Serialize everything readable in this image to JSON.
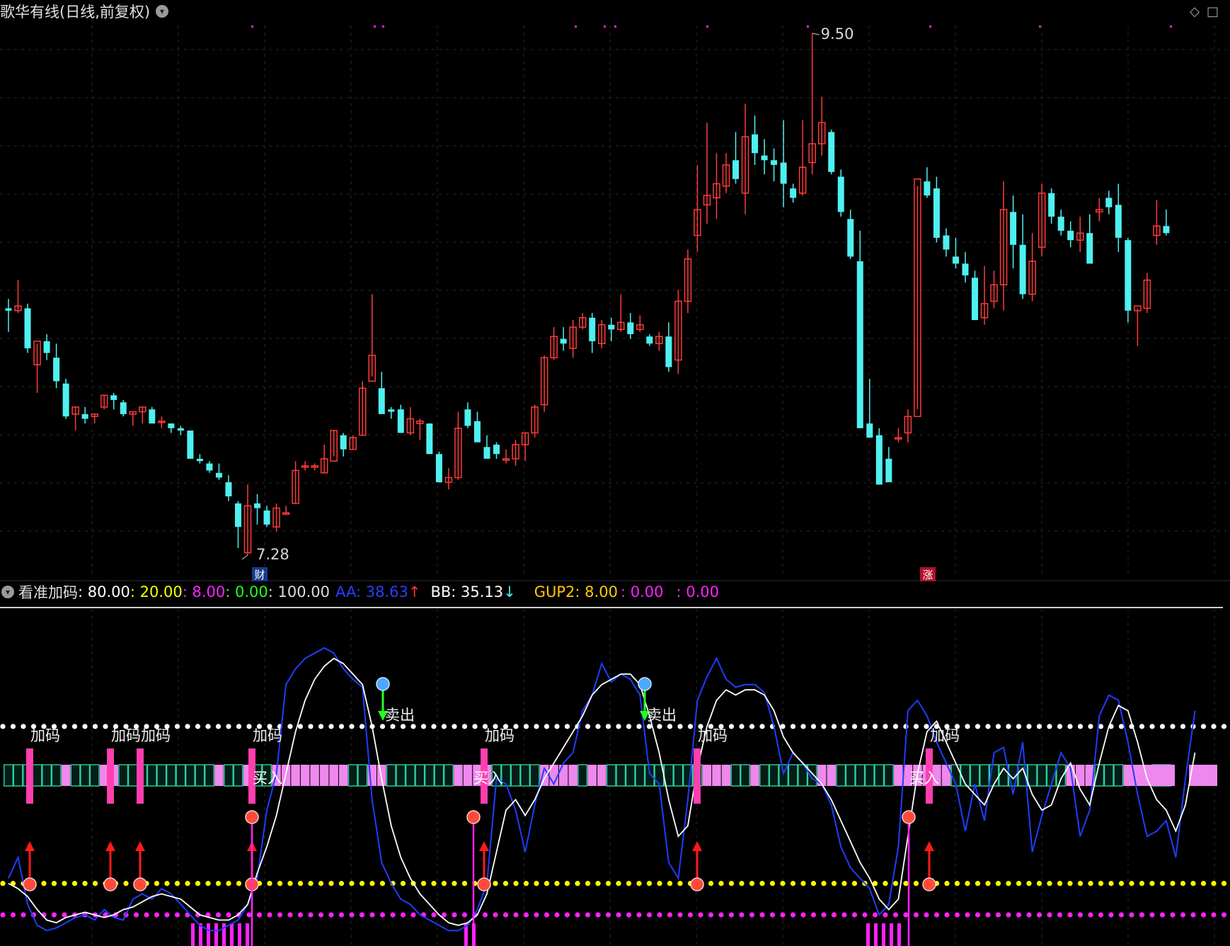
{
  "window": {
    "title": "歌华有线(日线,前复权)"
  },
  "colors": {
    "bg": "#000000",
    "up": "#ff3b3b",
    "down": "#4ff0f0",
    "grid": "#2a2a2a",
    "white": "#ffffff",
    "yellow": "#ffff00",
    "magenta": "#ff22ff",
    "blue": "#1f3dff",
    "green": "#22ff22",
    "pinkBlock": "#ee88ee",
    "tealBlock": "#2fd0a0",
    "hotPink": "#ff3fae"
  },
  "price_panel": {
    "high_label": "9.50",
    "low_label": "7.28",
    "badge_cai": "财",
    "badge_zhang": "涨"
  },
  "indicator_header": {
    "name": "看准加码",
    "v1": ": 80.00",
    "v2": ": 20.00",
    "v3": ": 8.00",
    "v4": ": 0.00",
    "v5": ": 100.00",
    "aa_label": "AA: 38.63",
    "aa_arrow": "↑",
    "bb_label": "BB: 35.13",
    "bb_arrow": "↓",
    "gup_label": "GUP2: 8.00",
    "g1": ": 0.00",
    "g2": ": 0.00"
  },
  "signals": {
    "add_label": "加码",
    "sell_label": "卖出",
    "buy_label": "买入"
  },
  "chart_data": [
    {
      "type": "candlestick",
      "title": "歌华有线(日线,前复权)",
      "ylim": [
        7.1,
        9.6
      ],
      "annotations": [
        {
          "text": "9.50",
          "at": "max high"
        },
        {
          "text": "7.28",
          "at": "min low"
        }
      ],
      "ohlc": [
        [
          8.33,
          8.37,
          8.23,
          8.32
        ],
        [
          8.32,
          8.45,
          8.31,
          8.34
        ],
        [
          8.33,
          8.35,
          8.14,
          8.16
        ],
        [
          8.09,
          8.18,
          7.97,
          8.19
        ],
        [
          8.19,
          8.22,
          8.11,
          8.14
        ],
        [
          8.12,
          8.18,
          7.99,
          8.02
        ],
        [
          8.01,
          8.03,
          7.86,
          7.87
        ],
        [
          7.88,
          7.91,
          7.81,
          7.91
        ],
        [
          7.88,
          7.91,
          7.84,
          7.86
        ],
        [
          7.87,
          7.88,
          7.84,
          7.88
        ],
        [
          7.91,
          7.96,
          7.9,
          7.96
        ],
        [
          7.96,
          7.97,
          7.9,
          7.94
        ],
        [
          7.93,
          7.94,
          7.87,
          7.88
        ],
        [
          7.88,
          7.89,
          7.83,
          7.89
        ],
        [
          7.89,
          7.91,
          7.84,
          7.91
        ],
        [
          7.9,
          7.91,
          7.84,
          7.84
        ],
        [
          7.85,
          7.87,
          7.82,
          7.85
        ],
        [
          7.84,
          7.84,
          7.8,
          7.82
        ],
        [
          7.82,
          7.83,
          7.79,
          7.81
        ],
        [
          7.81,
          7.81,
          7.7,
          7.69
        ],
        [
          7.69,
          7.71,
          7.67,
          7.68
        ],
        [
          7.67,
          7.68,
          7.63,
          7.64
        ],
        [
          7.63,
          7.67,
          7.6,
          7.61
        ],
        [
          7.59,
          7.62,
          7.51,
          7.53
        ],
        [
          7.5,
          7.51,
          7.31,
          7.4
        ],
        [
          7.29,
          7.58,
          7.28,
          7.49
        ],
        [
          7.5,
          7.54,
          7.41,
          7.48
        ],
        [
          7.47,
          7.49,
          7.4,
          7.41
        ],
        [
          7.4,
          7.5,
          7.38,
          7.48
        ],
        [
          7.46,
          7.49,
          7.45,
          7.46
        ],
        [
          7.5,
          7.68,
          7.5,
          7.64
        ],
        [
          7.66,
          7.68,
          7.64,
          7.66
        ],
        [
          7.66,
          7.67,
          7.64,
          7.66
        ],
        [
          7.63,
          7.75,
          7.63,
          7.69
        ],
        [
          7.68,
          7.81,
          7.7,
          7.81
        ],
        [
          7.79,
          7.8,
          7.7,
          7.73
        ],
        [
          7.73,
          7.79,
          7.73,
          7.78
        ],
        [
          7.79,
          8.02,
          7.79,
          7.99
        ],
        [
          8.02,
          8.39,
          8.04,
          8.13
        ],
        [
          7.99,
          8.06,
          7.89,
          7.88
        ],
        [
          7.9,
          7.91,
          7.86,
          7.89
        ],
        [
          7.9,
          7.92,
          7.8,
          7.8
        ],
        [
          7.8,
          7.91,
          7.79,
          7.86
        ],
        [
          7.84,
          7.86,
          7.77,
          7.85
        ],
        [
          7.84,
          7.84,
          7.73,
          7.71
        ],
        [
          7.71,
          7.72,
          7.59,
          7.59
        ],
        [
          7.59,
          7.65,
          7.56,
          7.61
        ],
        [
          7.61,
          7.89,
          7.6,
          7.82
        ],
        [
          7.9,
          7.93,
          7.82,
          7.83
        ],
        [
          7.85,
          7.89,
          7.76,
          7.76
        ],
        [
          7.74,
          7.79,
          7.71,
          7.69
        ],
        [
          7.75,
          7.76,
          7.69,
          7.71
        ],
        [
          7.69,
          7.73,
          7.67,
          7.69
        ],
        [
          7.69,
          7.77,
          7.66,
          7.75
        ],
        [
          7.75,
          7.8,
          7.68,
          7.8
        ],
        [
          7.8,
          7.92,
          7.78,
          7.91
        ],
        [
          7.92,
          8.13,
          7.89,
          8.12
        ],
        [
          8.12,
          8.25,
          8.11,
          8.21
        ],
        [
          8.2,
          8.25,
          8.15,
          8.18
        ],
        [
          8.16,
          8.28,
          8.12,
          8.25
        ],
        [
          8.25,
          8.31,
          8.24,
          8.29
        ],
        [
          8.29,
          8.31,
          8.14,
          8.19
        ],
        [
          8.18,
          8.28,
          8.16,
          8.26
        ],
        [
          8.26,
          8.29,
          8.19,
          8.24
        ],
        [
          8.24,
          8.39,
          8.23,
          8.27
        ],
        [
          8.27,
          8.31,
          8.2,
          8.22
        ],
        [
          8.24,
          8.3,
          8.23,
          8.26
        ],
        [
          8.21,
          8.22,
          8.17,
          8.18
        ],
        [
          8.18,
          8.23,
          8.15,
          8.21
        ],
        [
          8.21,
          8.27,
          8.06,
          8.08
        ],
        [
          8.11,
          8.41,
          8.05,
          8.36
        ],
        [
          8.36,
          8.58,
          8.31,
          8.54
        ],
        [
          8.64,
          8.94,
          8.57,
          8.75
        ],
        [
          8.77,
          9.12,
          8.69,
          8.81
        ],
        [
          8.8,
          8.99,
          8.71,
          8.86
        ],
        [
          8.85,
          8.99,
          8.82,
          8.94
        ],
        [
          8.96,
          9.08,
          8.86,
          8.88
        ],
        [
          8.82,
          9.2,
          8.73,
          9.06
        ],
        [
          9.07,
          9.15,
          8.94,
          8.99
        ],
        [
          8.98,
          9.05,
          8.9,
          8.96
        ],
        [
          8.96,
          9.01,
          8.87,
          8.94
        ],
        [
          8.95,
          9.13,
          8.76,
          8.86
        ],
        [
          8.84,
          8.86,
          8.78,
          8.8
        ],
        [
          8.82,
          9.13,
          8.81,
          8.93
        ],
        [
          8.95,
          9.5,
          8.9,
          9.03
        ],
        [
          9.03,
          9.23,
          8.98,
          9.12
        ],
        [
          9.08,
          9.09,
          8.9,
          8.91
        ],
        [
          8.89,
          8.92,
          8.72,
          8.74
        ],
        [
          8.71,
          8.75,
          8.54,
          8.55
        ],
        [
          8.53,
          8.66,
          7.84,
          7.82
        ],
        [
          7.84,
          8.03,
          7.79,
          7.78
        ],
        [
          7.79,
          7.82,
          7.63,
          7.58
        ],
        [
          7.69,
          7.74,
          7.64,
          7.59
        ],
        [
          7.78,
          7.82,
          7.76,
          7.78
        ],
        [
          7.8,
          7.9,
          7.76,
          7.87
        ],
        [
          7.87,
          8.85,
          7.9,
          8.88
        ],
        [
          8.87,
          8.93,
          8.8,
          8.81
        ],
        [
          8.84,
          8.89,
          8.61,
          8.63
        ],
        [
          8.64,
          8.67,
          8.55,
          8.58
        ],
        [
          8.55,
          8.63,
          8.5,
          8.52
        ],
        [
          8.52,
          8.57,
          8.44,
          8.47
        ],
        [
          8.46,
          8.49,
          8.28,
          8.28
        ],
        [
          8.29,
          8.51,
          8.26,
          8.35
        ],
        [
          8.36,
          8.49,
          8.33,
          8.43
        ],
        [
          8.43,
          8.87,
          8.32,
          8.75
        ],
        [
          8.74,
          8.81,
          8.5,
          8.6
        ],
        [
          8.6,
          8.73,
          8.37,
          8.39
        ],
        [
          8.39,
          8.65,
          8.36,
          8.53
        ],
        [
          8.59,
          8.86,
          8.55,
          8.82
        ],
        [
          8.82,
          8.84,
          8.69,
          8.72
        ],
        [
          8.72,
          8.75,
          8.64,
          8.66
        ],
        [
          8.66,
          8.7,
          8.59,
          8.62
        ],
        [
          8.62,
          8.72,
          8.57,
          8.65
        ],
        [
          8.65,
          8.73,
          8.59,
          8.52
        ],
        [
          8.74,
          8.8,
          8.7,
          8.75
        ],
        [
          8.8,
          8.83,
          8.73,
          8.76
        ],
        [
          8.77,
          8.86,
          8.57,
          8.63
        ],
        [
          8.62,
          8.63,
          8.27,
          8.32
        ],
        [
          8.32,
          8.33,
          8.17,
          8.34
        ],
        [
          8.33,
          8.48,
          8.31,
          8.45
        ],
        [
          8.64,
          8.79,
          8.6,
          8.68
        ],
        [
          8.68,
          8.75,
          8.64,
          8.65
        ]
      ]
    },
    {
      "type": "line",
      "title": "看准加码",
      "ylim": [
        -2,
        120
      ],
      "series": [
        {
          "name": "AA",
          "color": "#1f3dff"
        },
        {
          "name": "BB",
          "color": "#ffffff"
        },
        {
          "name": "GUP2",
          "color": "#ff22ff"
        }
      ],
      "levels": [
        80,
        20,
        8,
        0,
        100
      ],
      "aa": [
        22,
        30,
        12,
        4,
        2,
        3,
        5,
        7,
        8,
        6,
        10,
        7,
        6,
        14,
        16,
        14,
        18,
        16,
        12,
        8,
        4,
        2,
        2,
        4,
        6,
        12,
        22,
        48,
        62,
        96,
        102,
        106,
        108,
        110,
        108,
        102,
        98,
        95,
        52,
        28,
        20,
        14,
        12,
        8,
        6,
        4,
        2,
        2,
        4,
        10,
        20,
        60,
        58,
        48,
        32,
        50,
        64,
        58,
        66,
        70,
        86,
        92,
        104,
        97,
        100,
        98,
        92,
        62,
        58,
        28,
        22,
        52,
        90,
        99,
        106,
        98,
        95,
        96,
        96,
        93,
        80,
        62,
        70,
        66,
        60,
        58,
        50,
        34,
        26,
        22,
        18,
        8,
        12,
        34,
        86,
        90,
        84,
        74,
        66,
        58,
        40,
        58,
        44,
        70,
        72,
        54,
        74,
        32,
        46,
        58,
        70,
        64,
        38,
        48,
        84,
        92,
        90,
        74,
        54,
        38,
        40,
        44,
        30,
        60,
        86
      ],
      "bb": [
        20,
        18,
        15,
        10,
        6,
        5,
        7,
        8,
        9,
        8,
        7,
        8,
        10,
        11,
        13,
        15,
        16,
        15,
        14,
        11,
        8,
        7,
        6,
        6,
        8,
        12,
        24,
        34,
        46,
        62,
        78,
        90,
        98,
        103,
        106,
        104,
        100,
        96,
        80,
        60,
        42,
        30,
        22,
        16,
        12,
        8,
        5,
        4,
        5,
        8,
        16,
        32,
        48,
        52,
        46,
        52,
        60,
        66,
        72,
        78,
        84,
        92,
        96,
        98,
        100,
        100,
        96,
        84,
        70,
        52,
        38,
        42,
        64,
        80,
        90,
        94,
        92,
        94,
        94,
        92,
        86,
        76,
        70,
        66,
        62,
        58,
        52,
        44,
        36,
        28,
        22,
        14,
        10,
        14,
        38,
        62,
        78,
        82,
        74,
        66,
        58,
        54,
        50,
        58,
        64,
        60,
        64,
        54,
        48,
        50,
        60,
        66,
        56,
        50,
        66,
        80,
        88,
        86,
        74,
        60,
        52,
        48,
        40,
        50,
        70
      ]
    }
  ]
}
